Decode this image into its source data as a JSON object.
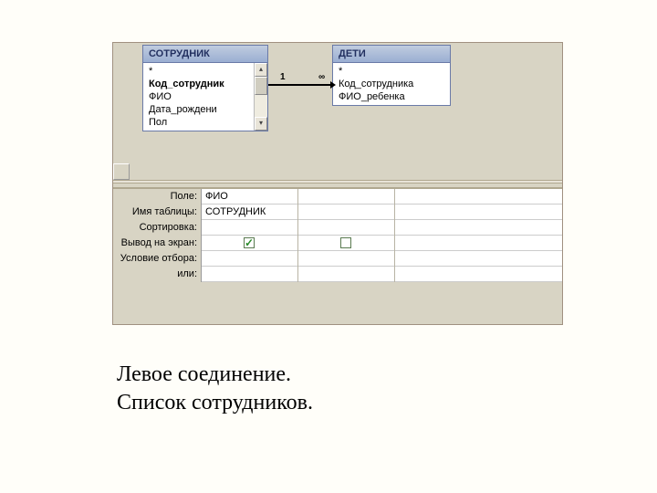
{
  "tables": {
    "employee": {
      "title": "СОТРУДНИК",
      "fields": [
        "*",
        "Код_сотрудник",
        "ФИО",
        "Дата_рождени",
        "Пол"
      ]
    },
    "children": {
      "title": "ДЕТИ",
      "fields": [
        "*",
        "Код_сотрудника",
        "ФИО_ребенка"
      ]
    }
  },
  "relation": {
    "left_label": "1",
    "right_label": "∞"
  },
  "grid_labels": {
    "field": "Поле:",
    "table": "Имя таблицы:",
    "sort": "Сортировка:",
    "show": "Вывод на экран:",
    "criteria": "Условие отбора:",
    "or": "или:"
  },
  "grid_values": {
    "col1": {
      "field": "ФИО",
      "table": "СОТРУДНИК",
      "show": true
    },
    "col2": {
      "field": "",
      "table": "",
      "show": false
    }
  },
  "caption": {
    "line1": "Левое соединение.",
    "line2": "Список сотрудников."
  }
}
